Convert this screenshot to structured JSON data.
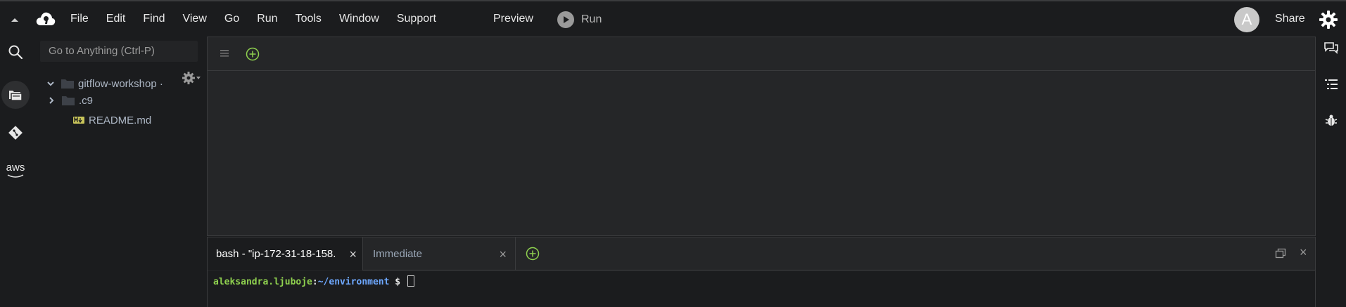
{
  "menubar": {
    "items": [
      "File",
      "Edit",
      "Find",
      "View",
      "Go",
      "Run",
      "Tools",
      "Window",
      "Support"
    ],
    "preview_label": "Preview",
    "run_label": "Run",
    "avatar_initial": "A",
    "share_label": "Share"
  },
  "filetree": {
    "search_placeholder": "Go to Anything (Ctrl-P)",
    "root_label": "gitflow-workshop ·",
    "children": [
      {
        "label": ".c9",
        "type": "folder"
      },
      {
        "label": "README.md",
        "type": "markdown"
      }
    ]
  },
  "left_rail": {
    "aws_label": "aws"
  },
  "terminal": {
    "tabs": [
      {
        "label": "bash - \"ip-172-31-18-158.",
        "close": "×"
      },
      {
        "label": "Immediate",
        "close": "×"
      }
    ],
    "close_pane": "×",
    "prompt_user": "aleksandra.ljuboje",
    "prompt_sep": ":",
    "prompt_path": "~/environment",
    "prompt_symbol": " $ "
  },
  "colors": {
    "background": "#1b1c1e",
    "panel": "#252628",
    "accent_green": "#8fd14f",
    "path_blue": "#6ea8ff"
  }
}
